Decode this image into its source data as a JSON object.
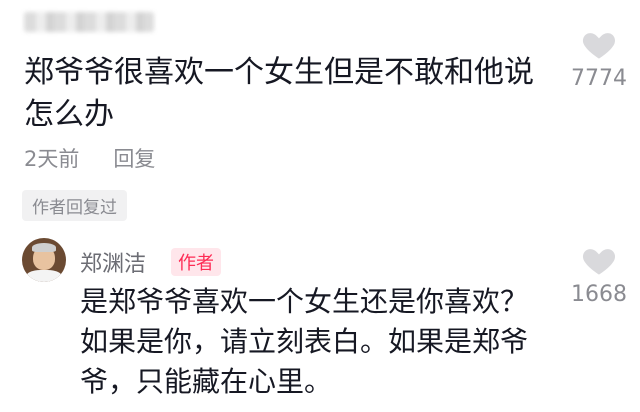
{
  "comment": {
    "text": "郑爷爷很喜欢一个女生但是不敢和他说怎么办",
    "time": "2天前",
    "reply_label": "回复",
    "author_replied_tag": "作者回复过",
    "likes": "7774"
  },
  "reply": {
    "username": "郑渊洁",
    "badge": "作者",
    "text": "是郑爷爷喜欢一个女生还是你喜欢？如果是你，请立刻表白。如果是郑爷爷，只能藏在心里。",
    "likes": "1668"
  },
  "icons": {
    "like": "heart-icon",
    "avatar": "avatar"
  },
  "colors": {
    "accent": "#fe2c55",
    "muted": "#8a8b91",
    "text": "#161823"
  }
}
